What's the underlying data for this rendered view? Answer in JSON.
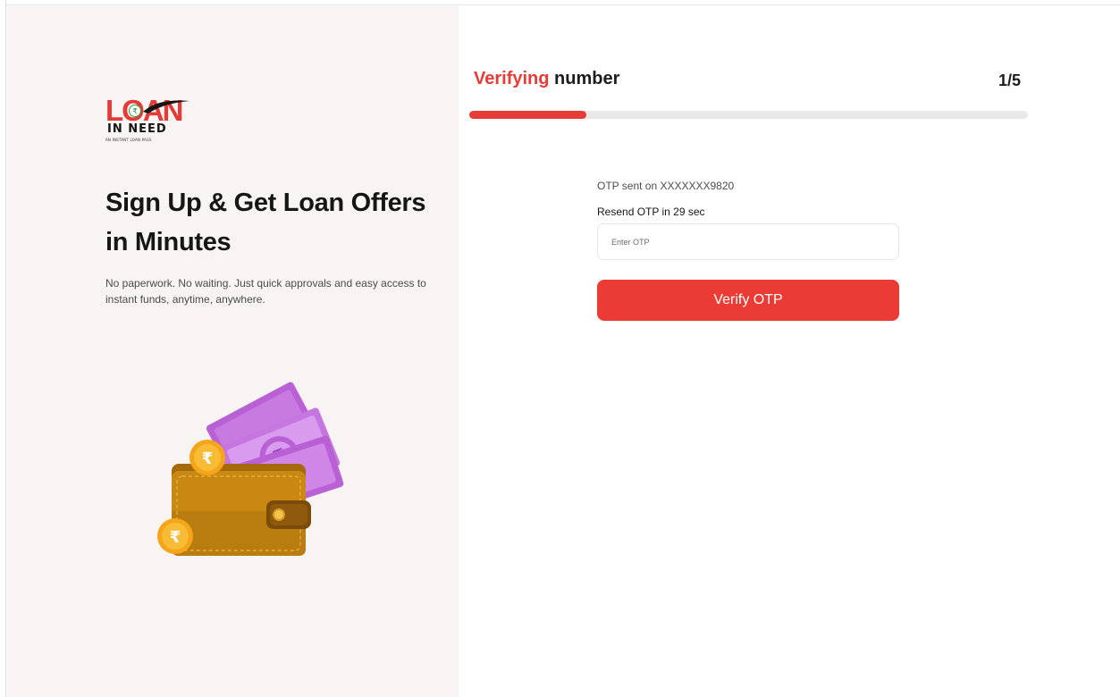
{
  "brand": {
    "logo_main": "LOAN",
    "logo_sub": "IN NEED",
    "logo_tagline": "AN INSTANT LOAN PASS",
    "accent_color": "#e73b36"
  },
  "hero": {
    "headline": "Sign Up & Get Loan Offers in Minutes",
    "subtext": "No paperwork. No waiting. Just quick approvals and easy access to instant funds, anytime, anywhere.",
    "illustration": "wallet-with-cash-icon"
  },
  "step": {
    "title_accent": "Verifying",
    "title_rest": " number",
    "counter": "1/5",
    "progress_fraction": 0.21
  },
  "otp": {
    "sent_text": "OTP sent on XXXXXXX9820",
    "resend_text": "Resend OTP in 29 sec",
    "input_value": "",
    "input_placeholder": "Enter OTP",
    "verify_label": "Verify OTP"
  }
}
